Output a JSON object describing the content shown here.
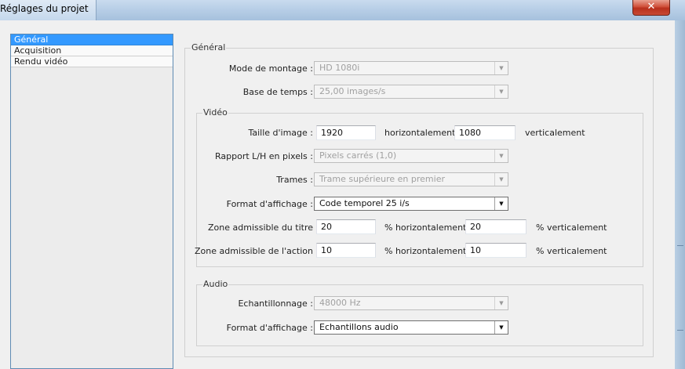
{
  "window": {
    "title": "Réglages du projet",
    "close_glyph": "✕"
  },
  "sidebar": {
    "items": [
      {
        "label": "Général",
        "selected": true
      },
      {
        "label": "Acquisition",
        "selected": false
      },
      {
        "label": "Rendu vidéo",
        "selected": false
      }
    ]
  },
  "general": {
    "title": "Général",
    "editing_mode": {
      "label": "Mode de montage :",
      "value": "HD 1080i"
    },
    "timebase": {
      "label": "Base de temps :",
      "value": "25,00 images/s"
    }
  },
  "video": {
    "title": "Vidéo",
    "frame_size": {
      "label": "Taille d'image :",
      "width": "1920",
      "horizontal_label": "horizontalement",
      "height": "1080",
      "vertical_label": "verticalement"
    },
    "pixel_aspect": {
      "label": "Rapport L/H en pixels :",
      "value": "Pixels carrés (1,0)"
    },
    "fields": {
      "label": "Trames :",
      "value": "Trame supérieure en premier"
    },
    "display_format": {
      "label": "Format d'affichage :",
      "value": "Code temporel 25 i/s"
    },
    "title_safe": {
      "label": "Zone admissible du titre",
      "h_value": "20",
      "h_label": "% horizontalement",
      "v_value": "20",
      "v_label": "% verticalement"
    },
    "action_safe": {
      "label": "Zone admissible de l'action",
      "h_value": "10",
      "h_label": "% horizontalement",
      "v_value": "10",
      "v_label": "% verticalement"
    }
  },
  "audio": {
    "title": "Audio",
    "sample_rate": {
      "label": "Echantillonnage :",
      "value": "48000 Hz"
    },
    "display_format": {
      "label": "Format d'affichage :",
      "value": "Echantillons audio"
    }
  },
  "icons": {
    "dropdown_arrow": "▼"
  },
  "colors": {
    "selection": "#3399ff",
    "close_button": "#c84a36"
  }
}
